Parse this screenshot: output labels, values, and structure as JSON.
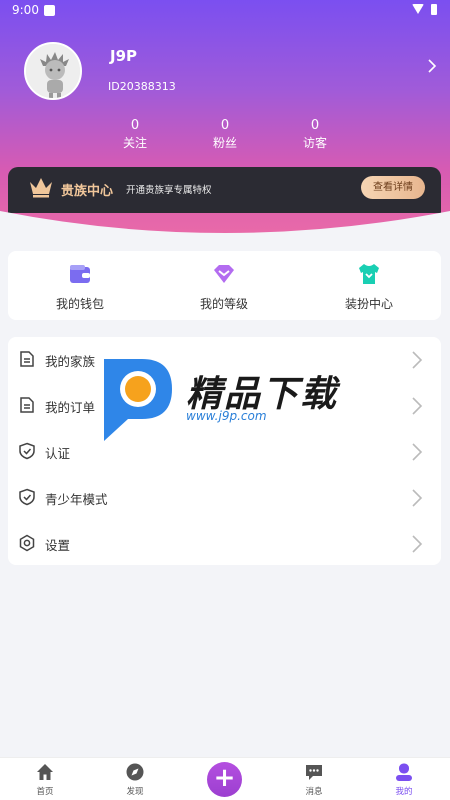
{
  "status_bar": {
    "time": "9:00"
  },
  "profile": {
    "name": "J9P",
    "id": "ID20388313"
  },
  "stats": [
    {
      "value": "0",
      "label": "关注"
    },
    {
      "value": "0",
      "label": "粉丝"
    },
    {
      "value": "0",
      "label": "访客"
    }
  ],
  "vip": {
    "title": "贵族中心",
    "desc": "开通贵族享专属特权",
    "button": "查看详情"
  },
  "quick_actions": [
    {
      "label": "我的钱包",
      "icon": "wallet-icon"
    },
    {
      "label": "我的等级",
      "icon": "level-icon"
    },
    {
      "label": "装扮中心",
      "icon": "dress-up-icon"
    }
  ],
  "menu": [
    {
      "label": "我的家族",
      "icon": "family-icon"
    },
    {
      "label": "我的订单",
      "icon": "order-icon"
    },
    {
      "label": "认证",
      "icon": "shield-icon"
    },
    {
      "label": "青少年模式",
      "icon": "shield-icon"
    },
    {
      "label": "设置",
      "icon": "gear-icon"
    }
  ],
  "watermark": {
    "text": "精品下载",
    "url": "www.j9p.com"
  },
  "tabs": [
    {
      "label": "首页",
      "icon": "home-icon"
    },
    {
      "label": "发现",
      "icon": "compass-icon"
    },
    {
      "label": "消息",
      "icon": "message-icon"
    },
    {
      "label": "我的",
      "icon": "user-icon",
      "active": true
    }
  ],
  "colors": {
    "brand": "#7b4ff0",
    "vip_gold": "#f0c69a",
    "background": "#f3f4f8"
  }
}
